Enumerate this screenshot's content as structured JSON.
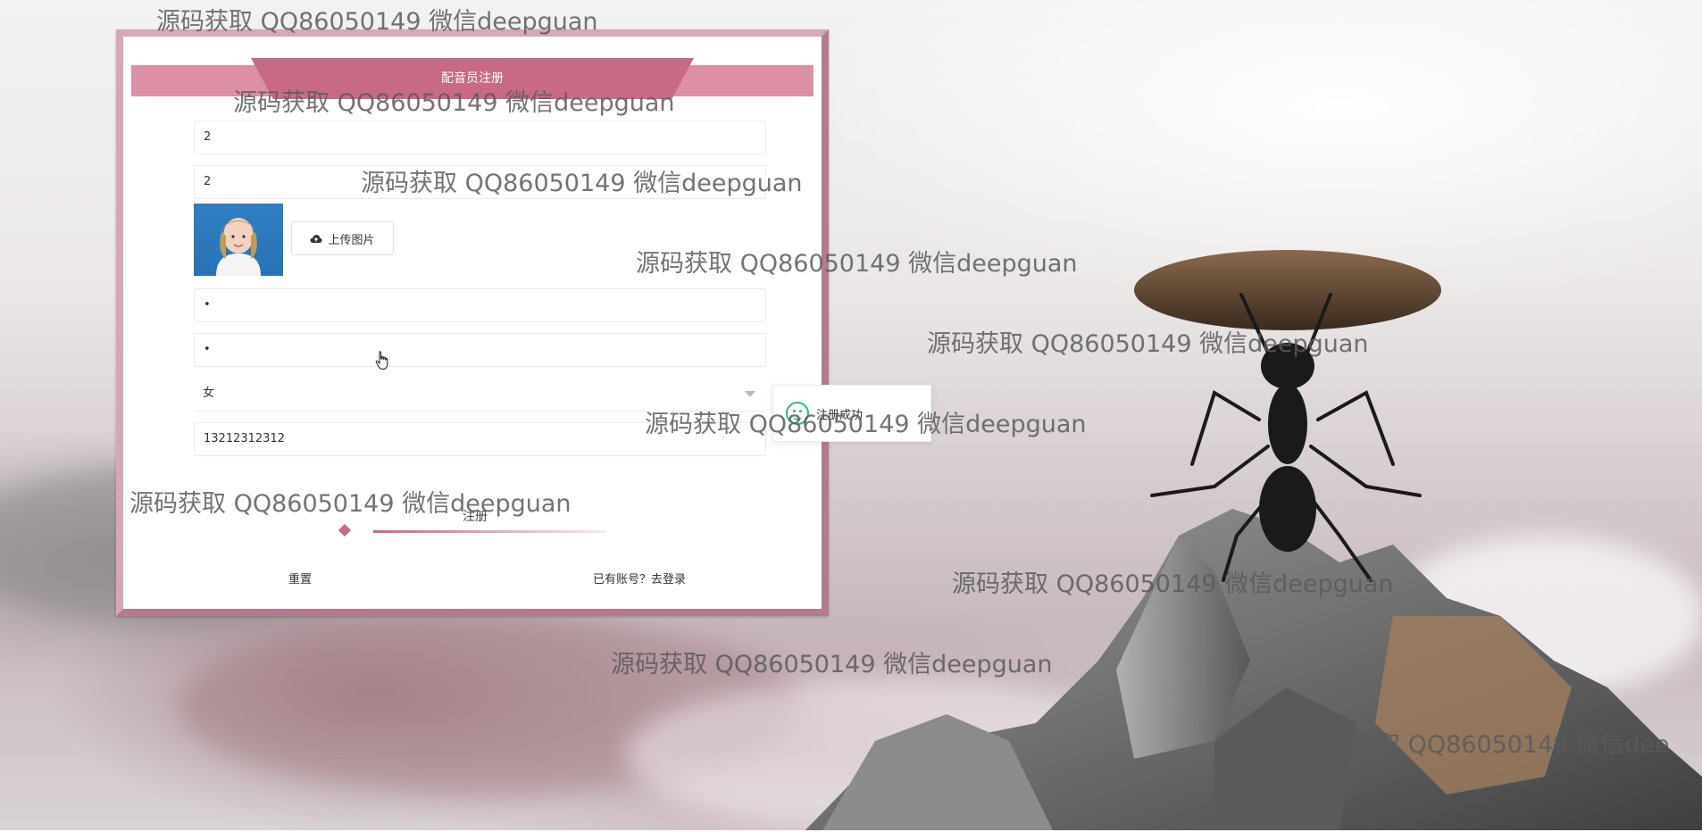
{
  "form": {
    "title": "配音员注册",
    "fields": [
      {
        "value": "2"
      },
      {
        "value": "2"
      },
      {
        "value": "•"
      },
      {
        "value": "•"
      }
    ],
    "upload_label": "上传图片",
    "gender_value": "女",
    "phone_value": "13212312312",
    "register_label": "注册",
    "reset_label": "重置",
    "login_label": "已有账号？去登录"
  },
  "toast": {
    "message": "注册成功",
    "color": "#2fbf71"
  },
  "watermark": {
    "text": "源码获取 QQ86050149 微信deepguan",
    "text_cut": "源码获取 QQ86050149 微信dee"
  },
  "colors": {
    "accent": "#c86a85",
    "ribbon": "#dd8fa6",
    "border": "#d6a7b6"
  },
  "icons": {
    "upload": "cloud-upload-icon",
    "select": "chevron-down-icon",
    "toast": "smile-icon",
    "cursor": "hand-pointer-icon"
  }
}
